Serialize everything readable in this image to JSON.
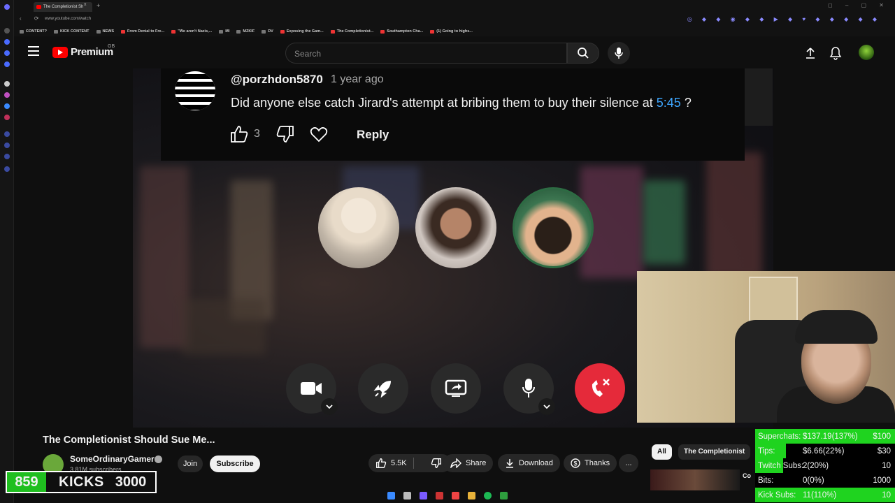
{
  "browser": {
    "tab_title": "The Completionist Sh",
    "tab_close": "x",
    "new_tab": "+",
    "url": "www.youtube.com/watch",
    "bookmarks": [
      "CONTENT?",
      "KICK CONTENT",
      "NEWS",
      "From Denial to Fre...",
      "\"We aren't Nazis,...",
      "MI",
      "MZKIF",
      "DV",
      "Exposing the Gam...",
      "The Completionist...",
      "Southampton Cha...",
      "(1) Going to highs..."
    ]
  },
  "header": {
    "logo": "Premium",
    "region": "GB",
    "search_placeholder": "Search"
  },
  "comment": {
    "username": "@porzhdon5870",
    "time": "1 year ago",
    "text": "Did anyone else catch Jirard's attempt at bribing them to buy their silence at",
    "timestamp_link": "5:45",
    "text_end": " ?",
    "like_count": "3",
    "reply_label": "Reply"
  },
  "video": {
    "title": "The Completionist Should Sue Me...",
    "channel": "SomeOrdinaryGamers",
    "subscribers": "3.81M subscribers",
    "join_label": "Join",
    "subscribe_label": "Subscribe",
    "likes": "5.5K",
    "share_label": "Share",
    "download_label": "Download",
    "thanks_label": "Thanks",
    "more_label": "..."
  },
  "chips": {
    "all": "All",
    "channel": "The Completionist"
  },
  "related": {
    "thumb_label": "Co"
  },
  "kicks": {
    "count": "859",
    "label": "KICKS",
    "goal": "3000"
  },
  "goals": [
    {
      "label": "Superchats:",
      "value": "$137.19(137%)",
      "target": "$100",
      "progress": 1.0
    },
    {
      "label": "Tips:",
      "value": "$6.66(22%)",
      "target": "$30",
      "progress": 0.22
    },
    {
      "label": "Twitch Subs:",
      "value": "2(20%)",
      "target": "10",
      "progress": 0.2
    },
    {
      "label": "Bits:",
      "value": "0(0%)",
      "target": "1000",
      "progress": 0.0
    },
    {
      "label": "Kick Subs:",
      "value": "11(110%)",
      "target": "10",
      "progress": 1.0
    }
  ],
  "colors": {
    "accent_red": "#ff0000",
    "link_blue": "#3ea6ff",
    "hangup_red": "#e52a3a",
    "goal_green": "#1fd31f"
  }
}
